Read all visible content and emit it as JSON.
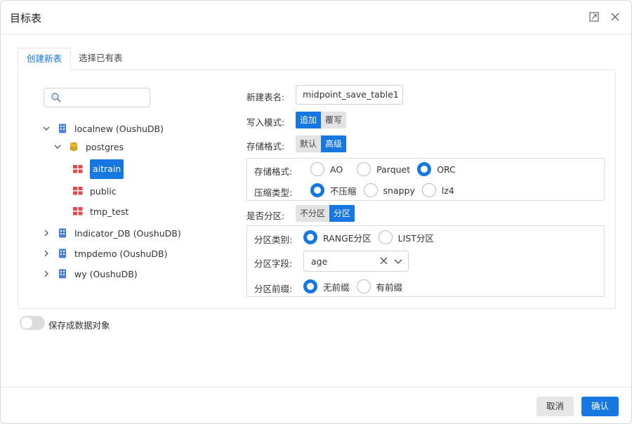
{
  "dialog": {
    "title": "目标表"
  },
  "tabs": [
    {
      "label": "创建新表",
      "active": true
    },
    {
      "label": "选择已有表",
      "active": false
    }
  ],
  "search": {
    "placeholder": ""
  },
  "tree": {
    "db1": "localnew (OushuDB)",
    "schema1": "postgres",
    "table1": "aitrain",
    "table2": "public",
    "table3": "tmp_test",
    "db2": "Indicator_DB (OushuDB)",
    "db3": "tmpdemo (OushuDB)",
    "db4": "wy (OushuDB)"
  },
  "form": {
    "table_name_label": "新建表名:",
    "table_name_value": "midpoint_save_table1",
    "write_mode_label": "写入模式:",
    "write_mode_options": [
      "追加",
      "覆写"
    ],
    "storage_label": "存储格式:",
    "storage_options": [
      "默认",
      "高级"
    ],
    "advanced": {
      "format_label": "存储格式:",
      "format_options": [
        "AO",
        "Parquet",
        "ORC"
      ],
      "compress_label": "压缩类型:",
      "compress_options": [
        "不压缩",
        "snappy",
        "lz4"
      ]
    },
    "partition_label": "是否分区:",
    "partition_options": [
      "不分区",
      "分区"
    ],
    "partition": {
      "type_label": "分区类别:",
      "type_options": [
        "RANGE分区",
        "LIST分区"
      ],
      "field_label": "分区字段:",
      "field_value": "age",
      "prefix_label": "分区前缀:",
      "prefix_options": [
        "无前缀",
        "有前缀"
      ]
    }
  },
  "save_as_object_label": "保存成数据对象",
  "footer": {
    "cancel": "取消",
    "confirm": "确认"
  },
  "colors": {
    "accent": "#1677e0",
    "table_icon": "#e04a4a",
    "db_icon": "#4a7fd6",
    "schema_icon": "#d9a520"
  }
}
